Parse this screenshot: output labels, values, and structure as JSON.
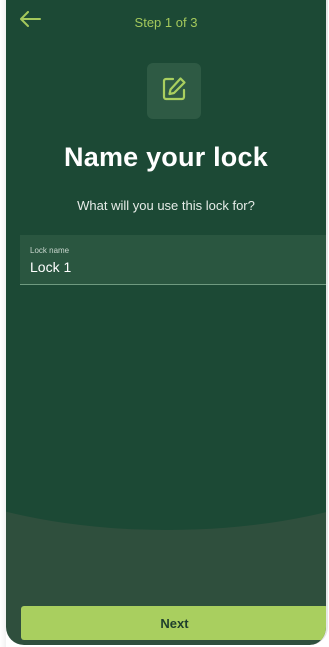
{
  "header": {
    "back_icon": "arrow-left-icon",
    "step": "Step 1 of 3"
  },
  "main": {
    "icon": "edit-pencil-icon",
    "title": "Name your lock",
    "subtitle": "What will you use this lock for?"
  },
  "form": {
    "lock_name_label": "Lock name",
    "lock_name_value": "Lock 1"
  },
  "footer": {
    "next_label": "Next"
  },
  "colors": {
    "accent": "#a9cf5f",
    "background_dark": "#1c4935",
    "background_light": "#2f4f3d"
  }
}
